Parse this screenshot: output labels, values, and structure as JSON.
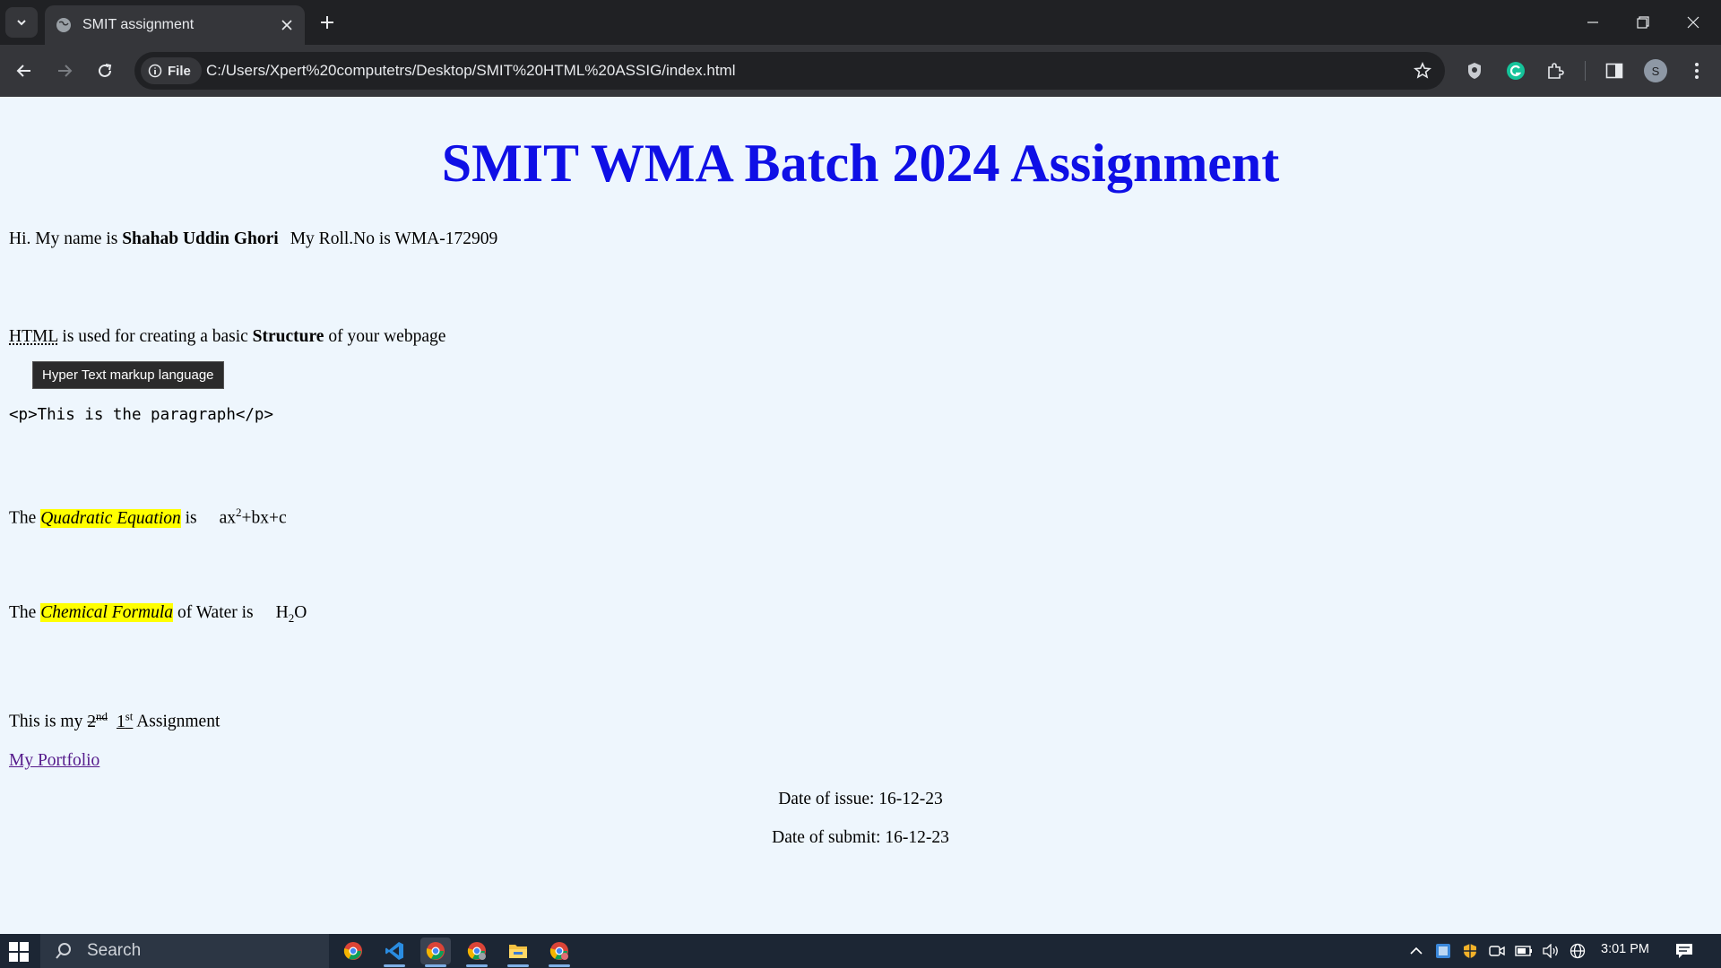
{
  "browser": {
    "tab_title": "SMIT assignment",
    "site_chip_label": "File",
    "url": "C:/Users/Xpert%20computetrs/Desktop/SMIT%20HTML%20ASSIG/index.html",
    "profile_initial": "S"
  },
  "page": {
    "title": "SMIT WMA Batch 2024 Assignment",
    "intro": {
      "prefix": "Hi. My name is ",
      "name": "Shahab Uddin Ghori",
      "roll": "My Roll.No is WMA-172909"
    },
    "html_line": {
      "abbr": "HTML",
      "middle": " is used for creating a basic ",
      "bold": "Structure",
      "suffix": " of your webpage"
    },
    "tooltip": "Hyper Text markup language",
    "code": "<p>This is the paragraph</p>",
    "quadratic": {
      "prefix": "The ",
      "highlight": "Quadratic Equation",
      "suffix": " is",
      "base": "ax",
      "exponent": "2",
      "rest": "+bx+c"
    },
    "chemical": {
      "prefix": "The ",
      "highlight": "Chemical Formula",
      "suffix": " of Water is",
      "h": "H",
      "sub": "2",
      "o": "O"
    },
    "assignment": {
      "prefix": "This is my ",
      "struck_num": "2",
      "struck_sup": "nd",
      "ins_num": "1",
      "ins_sup": "st",
      "suffix": " Assignment"
    },
    "portfolio_link": "My Portfolio",
    "date_issue": "Date of issue: 16-12-23",
    "date_submit": "Date of submit: 16-12-23"
  },
  "taskbar": {
    "search_label": "Search",
    "time": "3:01 PM"
  }
}
